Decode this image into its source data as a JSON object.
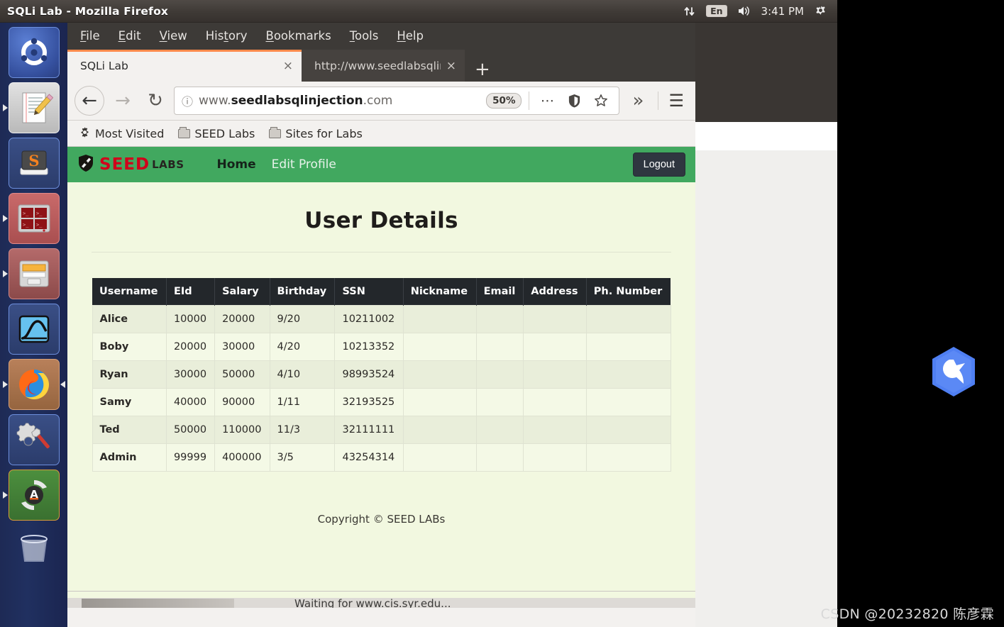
{
  "window": {
    "title": "SQLi Lab - Mozilla Firefox"
  },
  "top_panel": {
    "network_icon": "network-updown-icon",
    "keyboard_layout": "En",
    "volume_icon": "volume-icon",
    "clock": "3:41 PM",
    "session_icon": "gear-power-icon"
  },
  "launcher": {
    "items": [
      {
        "name": "ubuntu-dash",
        "label": "Ubuntu Dash"
      },
      {
        "name": "text-editor",
        "label": "Text Editor"
      },
      {
        "name": "sublime-text",
        "label": "Sublime Text"
      },
      {
        "name": "terminator",
        "label": "Terminator"
      },
      {
        "name": "file-manager",
        "label": "Files"
      },
      {
        "name": "wireshark",
        "label": "Wireshark"
      },
      {
        "name": "firefox",
        "label": "Firefox"
      },
      {
        "name": "system-settings",
        "label": "System Settings"
      },
      {
        "name": "anaconda",
        "label": "Anaconda Navigator"
      },
      {
        "name": "trash",
        "label": "Trash"
      }
    ]
  },
  "browser": {
    "menu": [
      "File",
      "Edit",
      "View",
      "History",
      "Bookmarks",
      "Tools",
      "Help"
    ],
    "menu_mnemonics": [
      "F",
      "E",
      "V",
      "t",
      "B",
      "T",
      "H"
    ],
    "tabs": [
      {
        "title": "SQLi Lab",
        "active": true,
        "close": "×"
      },
      {
        "title": "http://www.seedlabsqlinje",
        "active": false,
        "close": "×"
      }
    ],
    "new_tab_label": "+",
    "nav": {
      "back": "←",
      "forward": "→",
      "reload": "↻",
      "info_icon": "info-circle-icon",
      "url_prefix": "www.",
      "url_strong": "seedlabsqlinjection",
      "url_suffix": ".com",
      "url_full": "www.seedlabsqlinjection.com",
      "zoom_level": "50%",
      "more_icon": "ellipsis-icon",
      "shield_icon": "shield-icon",
      "bookmark_icon": "star-icon",
      "overflow_icon": "chevron-double-right-icon",
      "menu_icon": "hamburger-icon"
    },
    "bookmarks": [
      {
        "label": "Most Visited",
        "icon": "gear-icon"
      },
      {
        "label": "SEED Labs",
        "icon": "folder-icon"
      },
      {
        "label": "Sites for Labs",
        "icon": "folder-icon"
      }
    ],
    "status_text": "Waiting for www.cis.syr.edu..."
  },
  "page": {
    "brand": {
      "shield_icon": "seed-shield-icon",
      "seed": "SEED",
      "labs": "LABS"
    },
    "nav_links": [
      {
        "label": "Home",
        "active": true
      },
      {
        "label": "Edit Profile",
        "active": false
      }
    ],
    "logout_label": "Logout",
    "title": "User Details",
    "table": {
      "columns": [
        "Username",
        "EId",
        "Salary",
        "Birthday",
        "SSN",
        "Nickname",
        "Email",
        "Address",
        "Ph. Number"
      ],
      "rows": [
        {
          "Username": "Alice",
          "EId": "10000",
          "Salary": "20000",
          "Birthday": "9/20",
          "SSN": "10211002",
          "Nickname": "",
          "Email": "",
          "Address": "",
          "Ph. Number": ""
        },
        {
          "Username": "Boby",
          "EId": "20000",
          "Salary": "30000",
          "Birthday": "4/20",
          "SSN": "10213352",
          "Nickname": "",
          "Email": "",
          "Address": "",
          "Ph. Number": ""
        },
        {
          "Username": "Ryan",
          "EId": "30000",
          "Salary": "50000",
          "Birthday": "4/10",
          "SSN": "98993524",
          "Nickname": "",
          "Email": "",
          "Address": "",
          "Ph. Number": ""
        },
        {
          "Username": "Samy",
          "EId": "40000",
          "Salary": "90000",
          "Birthday": "1/11",
          "SSN": "32193525",
          "Nickname": "",
          "Email": "",
          "Address": "",
          "Ph. Number": ""
        },
        {
          "Username": "Ted",
          "EId": "50000",
          "Salary": "110000",
          "Birthday": "11/3",
          "SSN": "32111111",
          "Nickname": "",
          "Email": "",
          "Address": "",
          "Ph. Number": ""
        },
        {
          "Username": "Admin",
          "EId": "99999",
          "Salary": "400000",
          "Birthday": "3/5",
          "SSN": "43254314",
          "Nickname": "",
          "Email": "",
          "Address": "",
          "Ph. Number": ""
        }
      ]
    },
    "copyright": "Copyright © SEED LABs"
  },
  "desktop": {
    "floating_icon": "hummingbird-hex-icon",
    "watermark": "CSDN @20232820 陈彦霖"
  },
  "colors": {
    "nav_green": "#41a85f",
    "page_bg": "#f2f8e0",
    "table_header": "#23272b",
    "row_odd": "#e9eeda",
    "row_even": "#f4f9e6",
    "brand_red": "#d0021b",
    "firefox_accent": "#ff8a4c"
  }
}
